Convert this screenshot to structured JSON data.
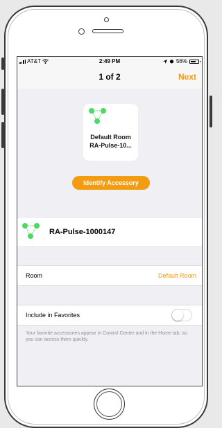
{
  "status_bar": {
    "carrier": "AT&T",
    "time": "2:49 PM",
    "battery_percent": "56%",
    "signal_icon": "signal-bars-icon",
    "wifi_icon": "wifi-icon",
    "location_icon": "location-arrow-icon",
    "alarm_icon": "alarm-icon",
    "battery_icon": "battery-icon"
  },
  "nav": {
    "title": "1 of 2",
    "next_label": "Next"
  },
  "accessory_tile": {
    "icon": "accessory-network-icon",
    "line1": "Default Room",
    "line2": "RA-Pulse-10..."
  },
  "identify_button": {
    "label": "Identify Accessory"
  },
  "accessory": {
    "icon": "accessory-network-icon",
    "name": "RA-Pulse-1000147"
  },
  "room": {
    "label": "Room",
    "value": "Default Room"
  },
  "favorites": {
    "label": "Include in Favorites",
    "enabled": false,
    "note": "Your favorite accessories appear in Control Center and in the Home tab, so you can access them quickly."
  },
  "colors": {
    "accent": "#f39c12",
    "icon_green": "#4cd964",
    "background": "#efeff4"
  }
}
